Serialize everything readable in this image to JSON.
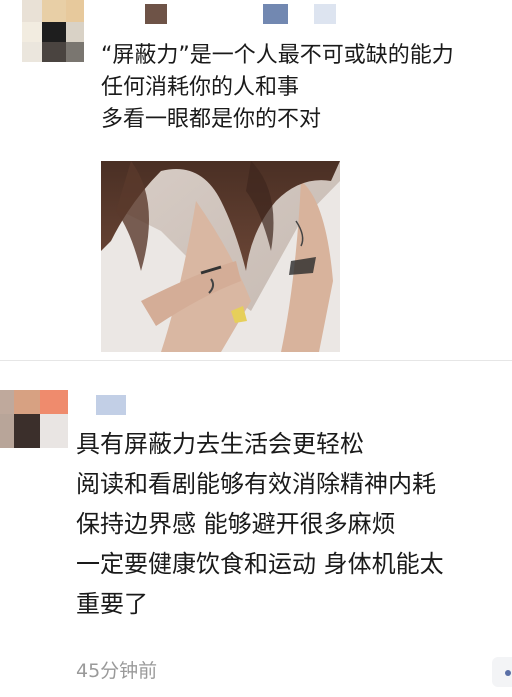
{
  "comments": [
    {
      "lines": [
        "“屏蔽力”是一个人最不可或缺的能力",
        "任何消耗你的人和事",
        "多看一眼都是你的不对"
      ],
      "has_image": true
    },
    {
      "lines": [
        "具有屏蔽力去生活会更轻松",
        "阅读和看剧能够有效消除精神内耗",
        "保持边界感 能够避开很多麻烦",
        "一定要健康饮食和运动 身体机能太",
        "重要了"
      ],
      "timestamp": "45分钟前"
    }
  ],
  "icons": {
    "more": "more-dot-icon"
  },
  "colors": {
    "text": "#1a1a1a",
    "timestamp": "#9a9a9a",
    "divider": "#e6e6e6"
  }
}
